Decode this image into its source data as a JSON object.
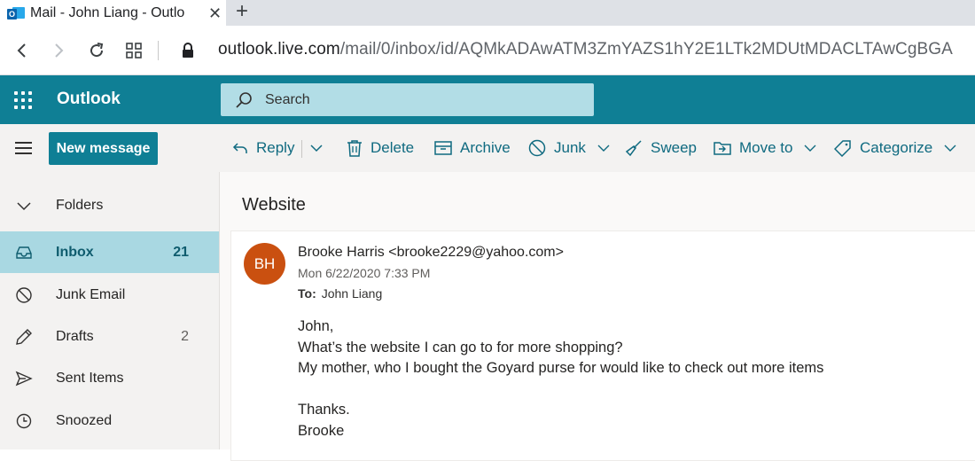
{
  "browser": {
    "tab_title": "Mail - John Liang - Outlo",
    "tab_close": "✕",
    "new_tab": "+",
    "url_host": "outlook.live.com",
    "url_path": "/mail/0/inbox/id/AQMkADAwATM3ZmYAZS1hY2E1LTk2MDUtMDACLTAwCgBGA"
  },
  "header": {
    "brand": "Outlook",
    "search_placeholder": "Search",
    "accent_color": "#0f7f95"
  },
  "commands": {
    "new_message": "New message",
    "reply": "Reply",
    "delete": "Delete",
    "archive": "Archive",
    "junk": "Junk",
    "sweep": "Sweep",
    "move_to": "Move to",
    "categorize": "Categorize"
  },
  "nav": {
    "folders_label": "Folders",
    "items": [
      {
        "label": "Inbox",
        "count": "21",
        "icon": "inbox-icon"
      },
      {
        "label": "Junk Email",
        "count": "",
        "icon": "junk-icon"
      },
      {
        "label": "Drafts",
        "count": "2",
        "icon": "drafts-icon"
      },
      {
        "label": "Sent Items",
        "count": "",
        "icon": "sent-icon"
      },
      {
        "label": "Snoozed",
        "count": "",
        "icon": "clock-icon"
      }
    ]
  },
  "message": {
    "subject": "Website",
    "avatar_initials": "BH",
    "avatar_color": "#ca5010",
    "from": "Brooke Harris <brooke2229@yahoo.com>",
    "date": "Mon 6/22/2020 7:33 PM",
    "to_label": "To:",
    "to_name": "John Liang",
    "body": [
      "John,",
      "What’s the website I can go to for more shopping?",
      "My mother, who I bought the Goyard purse for would like to check out more items",
      "",
      "Thanks.",
      "Brooke"
    ]
  }
}
